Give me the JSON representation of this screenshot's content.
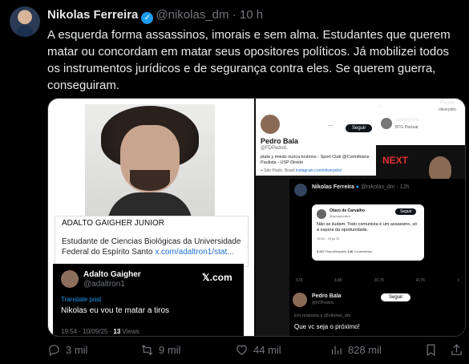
{
  "header": {
    "name": "Nikolas Ferreira",
    "handle": "@nikolas_dm",
    "separator": "·",
    "time": "10 h"
  },
  "tweet": {
    "text": "A esquerda forma assassinos, imorais e sem alma. Estudantes que querem matar ou concordam em matar seus opositores políticos. Já mobilizei todos os instrumentos jurídicos e de segurança contra eles. Se querem guerra, conseguiram."
  },
  "media_left": {
    "card_title": "ADALTO GAIGHER JUNIOR",
    "card_desc": "Estudante de Ciencias Biológicas da Universidade Federal do Espírito Santo",
    "card_link": "x.com/adaltron1/stat...",
    "post_name": "Adalto Gaigher",
    "post_handle": "@adaltron1",
    "x_logo": "𝕏.com",
    "translate": "Translate post",
    "post_text": "Nikolas eu vou te matar a tiros",
    "post_time": "19:54 · 10/09/25 ·",
    "post_views": "13",
    "post_views_label": "Views"
  },
  "media_right": {
    "profile_name": "Pedro Bala",
    "profile_handle": "@FDPedroL",
    "follow": "Seguir",
    "bio": "plata y miedo nunca tuvimos - Sport Club @Corinthians Paulista - USP Direito",
    "location": "São Paulo, Brasil",
    "link": "instagram.com/oliverpdro/",
    "posts_label": "Posts",
    "posts_handle": "oliverpdro",
    "ad_user": "oliverpdro",
    "ad_company": "BTG Pactual",
    "ad_tag": "NEXT",
    "inner_name": "Nikolas Ferreira",
    "inner_handle": "@nikolas_dm · 12h",
    "quote_name": "Olavo de Carvalho",
    "quote_handle": "@opropriolavo",
    "quote_text": "Não se iludam. Todo comunista é um assassino, só à espera da oportunidade.",
    "quote_time": "18:54 · 29 jul 21",
    "quote_reposts": "3.217",
    "quote_reposts_label": "Republicações",
    "quote_comments": "146",
    "quote_comments_label": "Comentários",
    "inner_stats": [
      "578",
      "3,8K",
      "20,7K",
      "417K"
    ],
    "reply_name": "Pedro Bala",
    "reply_handle": "@FDPedroL",
    "reply_follow": "Seguir",
    "reply_to": "Em resposta a @nikolas_dm",
    "reply_text": "Que vc seja o próximo!"
  },
  "actions": {
    "replies": "3 mil",
    "reposts": "9 mil",
    "likes": "44 mil",
    "views": "828 mil"
  }
}
